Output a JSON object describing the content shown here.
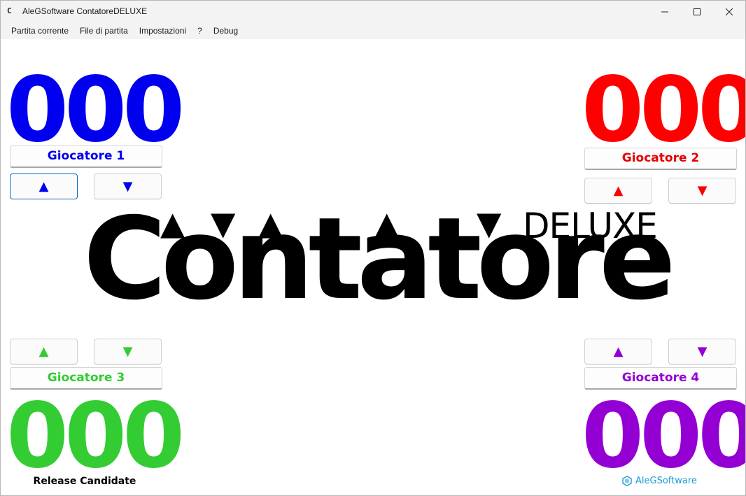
{
  "window": {
    "title": "AleGSoftware ContatoreDELUXE",
    "icon_glyph": "C"
  },
  "menu": {
    "items": [
      "Partita corrente",
      "File di partita",
      "Impostazioni",
      "?",
      "Debug"
    ]
  },
  "players": [
    {
      "name": "Giocatore 1",
      "score": "000",
      "color": "#0000ee",
      "up": "▲",
      "down": "▼"
    },
    {
      "name": "Giocatore 2",
      "score": "000",
      "color": "#ff0000",
      "up": "▲",
      "down": "▼"
    },
    {
      "name": "Giocatore 3",
      "score": "000",
      "color": "#33cc33",
      "up": "▲",
      "down": "▼"
    },
    {
      "name": "Giocatore 4",
      "score": "000",
      "color": "#9400d3",
      "up": "▲",
      "down": "▼"
    }
  ],
  "logo": {
    "main": "Contatore",
    "suffix": "DELUXE",
    "arrows": [
      "▲",
      "▼",
      "▲",
      "▲",
      "▼"
    ]
  },
  "footer": {
    "release": "Release Candidate",
    "brand": "AleGSoftware",
    "brand_color": "#1a9ad6",
    "brand_icon": "hexagon-logo-icon"
  }
}
